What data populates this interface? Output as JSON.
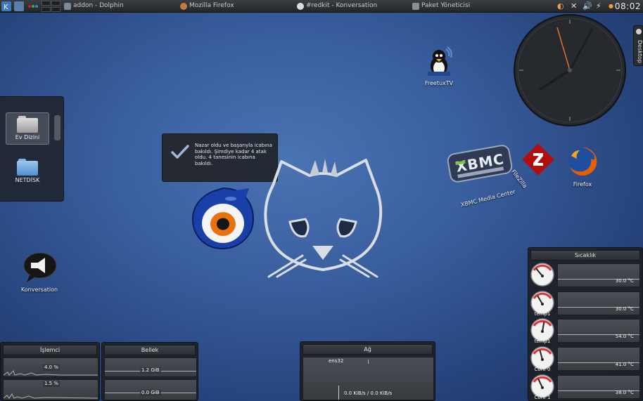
{
  "panel": {
    "tasks": [
      {
        "label": "addon - Dolphin"
      },
      {
        "label": "Mozilla Firefox"
      },
      {
        "label": "#redkit - Konversation"
      },
      {
        "label": "Paket Yöneticisi"
      }
    ],
    "clock": "08:02",
    "tray_icons": [
      "night-light-icon",
      "network-tools-icon",
      "volume-icon",
      "power-plug-icon",
      "menu-arrow-icon"
    ]
  },
  "desktop_tab": {
    "label": "Desktop"
  },
  "folder_view": {
    "items": [
      {
        "label": "Ev Dizini"
      },
      {
        "label": "NETDİSK"
      }
    ]
  },
  "notification": {
    "text": "Nazar oldu ve başarıyla icabına bakıldı. Şimdiye kadar 4 atak oldu. 4 tanesinin icabına bakıldı."
  },
  "desktop_icons": {
    "freetuxtv": "FreetuxTV",
    "xbmc": "XBMC Media Center",
    "filezilla": "FileZilla",
    "firefox": "Firefox",
    "konversation": "Konversation"
  },
  "widgets": {
    "cpu": {
      "title": "İşlemci",
      "values": [
        "4.0 %",
        "1.5 %"
      ]
    },
    "memory": {
      "title": "Bellek",
      "values": [
        "1.2 GiB",
        "0.0 GiB"
      ]
    },
    "network": {
      "title": "Ağ",
      "interface": "ens32",
      "rate": "0.0 KiB/s / 0.0 KiB/s"
    },
    "temperature": {
      "title": "Sıcaklık",
      "sensors": [
        {
          "label": "",
          "value": "30.0 °C"
        },
        {
          "label": "temp1",
          "value": "30.0 °C"
        },
        {
          "label": "temp1",
          "value": "54.0 °C"
        },
        {
          "label": "Core 0",
          "value": "41.0 °C"
        },
        {
          "label": "Core 1",
          "value": "38.0 °C"
        }
      ]
    }
  },
  "colors": {
    "wallpaper": "#3a5f9f",
    "panel": "#2b2e33",
    "accent_orange": "#e08a3c",
    "firefox_orange": "#e66000"
  }
}
